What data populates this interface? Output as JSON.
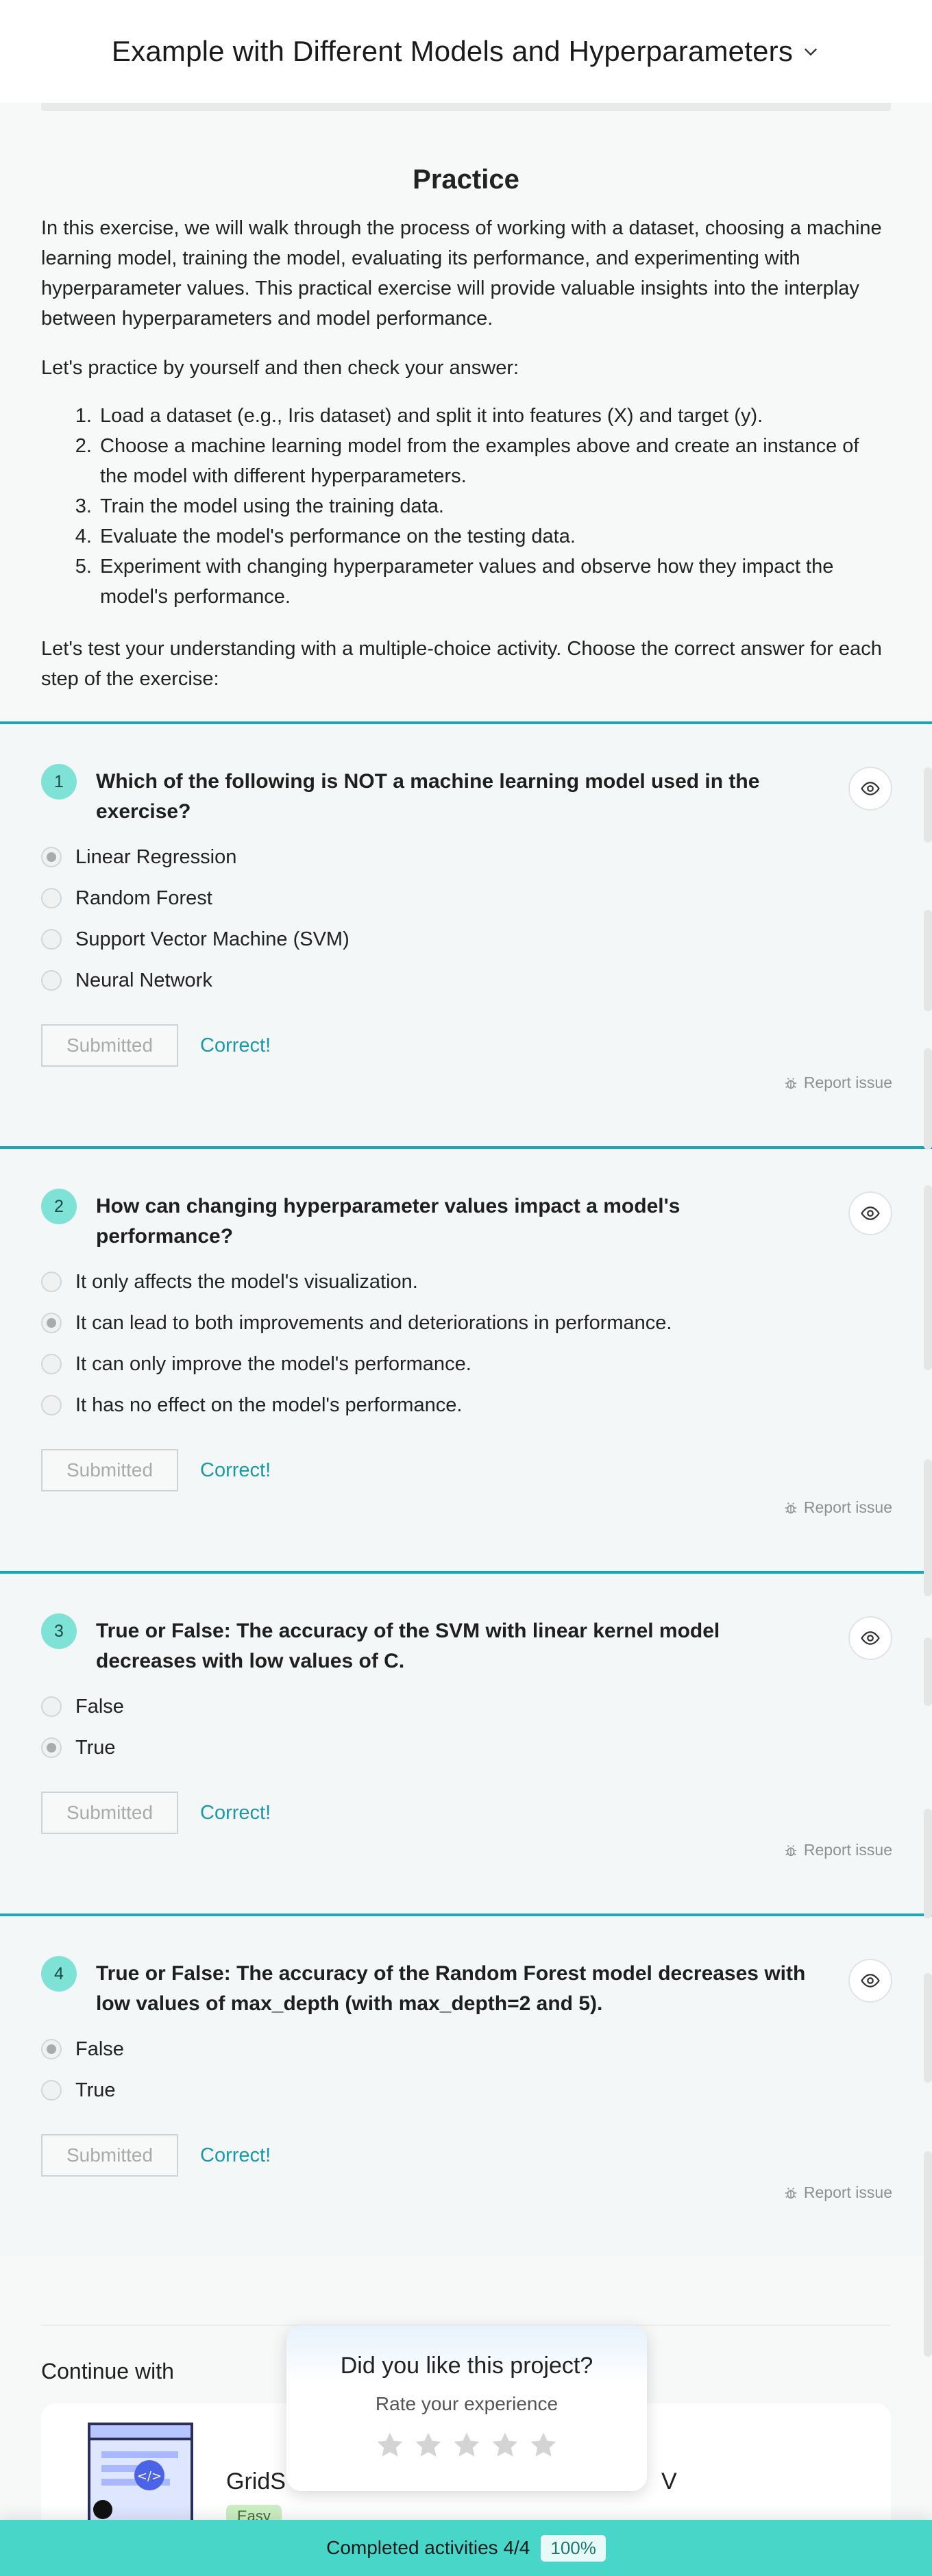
{
  "header": {
    "title": "Example with Different Models and Hyperparameters"
  },
  "practice": {
    "title": "Practice",
    "intro": "In this exercise, we will walk through the process of working with a dataset, choosing a machine learning model, training the model, evaluating its performance, and experimenting with hyperparameter values. This practical exercise will provide valuable insights into the interplay between hyperparameters and model performance.",
    "prompt": "Let's practice by yourself and then check your answer:",
    "steps": [
      "Load a dataset (e.g., Iris dataset) and split it into features (X) and target (y).",
      "Choose a machine learning model from the examples above and create an instance of the model with different hyperparameters.",
      "Train the model using the training data.",
      "Evaluate the model's performance on the testing data.",
      "Experiment with changing hyperparameter values and observe how they impact the model's performance."
    ],
    "quiz_intro": "Let's test your understanding with a multiple-choice activity. Choose the correct answer for each step of the exercise:"
  },
  "quizzes": [
    {
      "number": "1",
      "question": "Which of the following is NOT a machine learning model used in the exercise?",
      "options": [
        "Linear Regression",
        "Random Forest",
        "Support Vector Machine (SVM)",
        "Neural Network"
      ],
      "selected": 0,
      "button": "Submitted",
      "result": "Correct!",
      "report": "Report issue"
    },
    {
      "number": "2",
      "question": "How can changing hyperparameter values impact a model's performance?",
      "options": [
        "It only affects the model's visualization.",
        "It can lead to both improvements and deteriorations in performance.",
        "It can only improve the model's performance.",
        "It has no effect on the model's performance."
      ],
      "selected": 1,
      "button": "Submitted",
      "result": "Correct!",
      "report": "Report issue"
    },
    {
      "number": "3",
      "question": "True or False: The accuracy of the SVM with linear kernel model decreases with low values of C.",
      "options": [
        "False",
        "True"
      ],
      "selected": 1,
      "button": "Submitted",
      "result": "Correct!",
      "report": "Report issue"
    },
    {
      "number": "4",
      "question": "True or False: The accuracy of the Random Forest model decreases with low values of max_depth (with max_depth=2 and 5).",
      "options": [
        "False",
        "True"
      ],
      "selected": 0,
      "button": "Submitted",
      "result": "Correct!",
      "report": "Report issue"
    }
  ],
  "continue": {
    "title": "Continue with",
    "card_title_start": "GridS",
    "card_title_end": "V",
    "difficulty": "Easy"
  },
  "rating": {
    "title": "Did you like this project?",
    "subtitle": "Rate your experience",
    "stars": 5
  },
  "footer": {
    "label": "Completed activities 4/4",
    "percent": "100%"
  },
  "colors": {
    "accent": "#1aa7b5",
    "number_badge": "#7ee3d6",
    "footer": "#48d6c9",
    "correct": "#1a9aa6"
  }
}
